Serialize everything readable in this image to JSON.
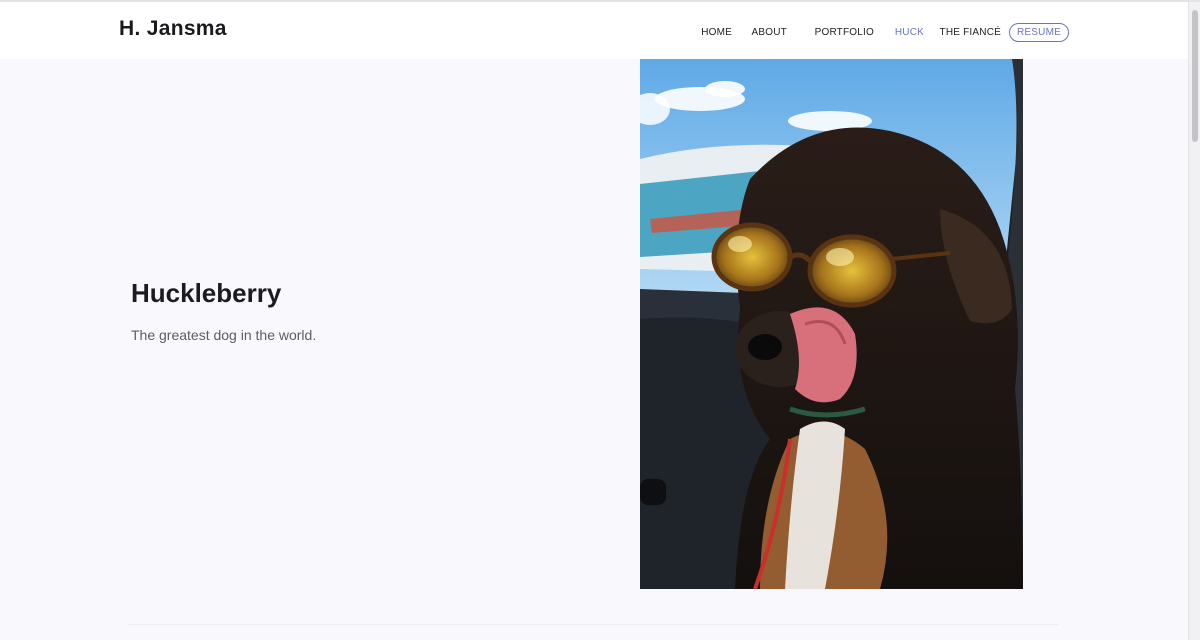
{
  "brand": {
    "name": "H. Jansma"
  },
  "nav": {
    "home": "HOME",
    "about": "ABOUT",
    "portfolio": "PORTFOLIO",
    "huck": "HUCK",
    "fiance": "THE FIANCÉ",
    "resume": "RESUME"
  },
  "hero": {
    "title": "Huckleberry",
    "subtitle": "The greatest dog in the world."
  },
  "colors": {
    "accent": "#6b73c9",
    "page_background": "#f9f9fd"
  }
}
